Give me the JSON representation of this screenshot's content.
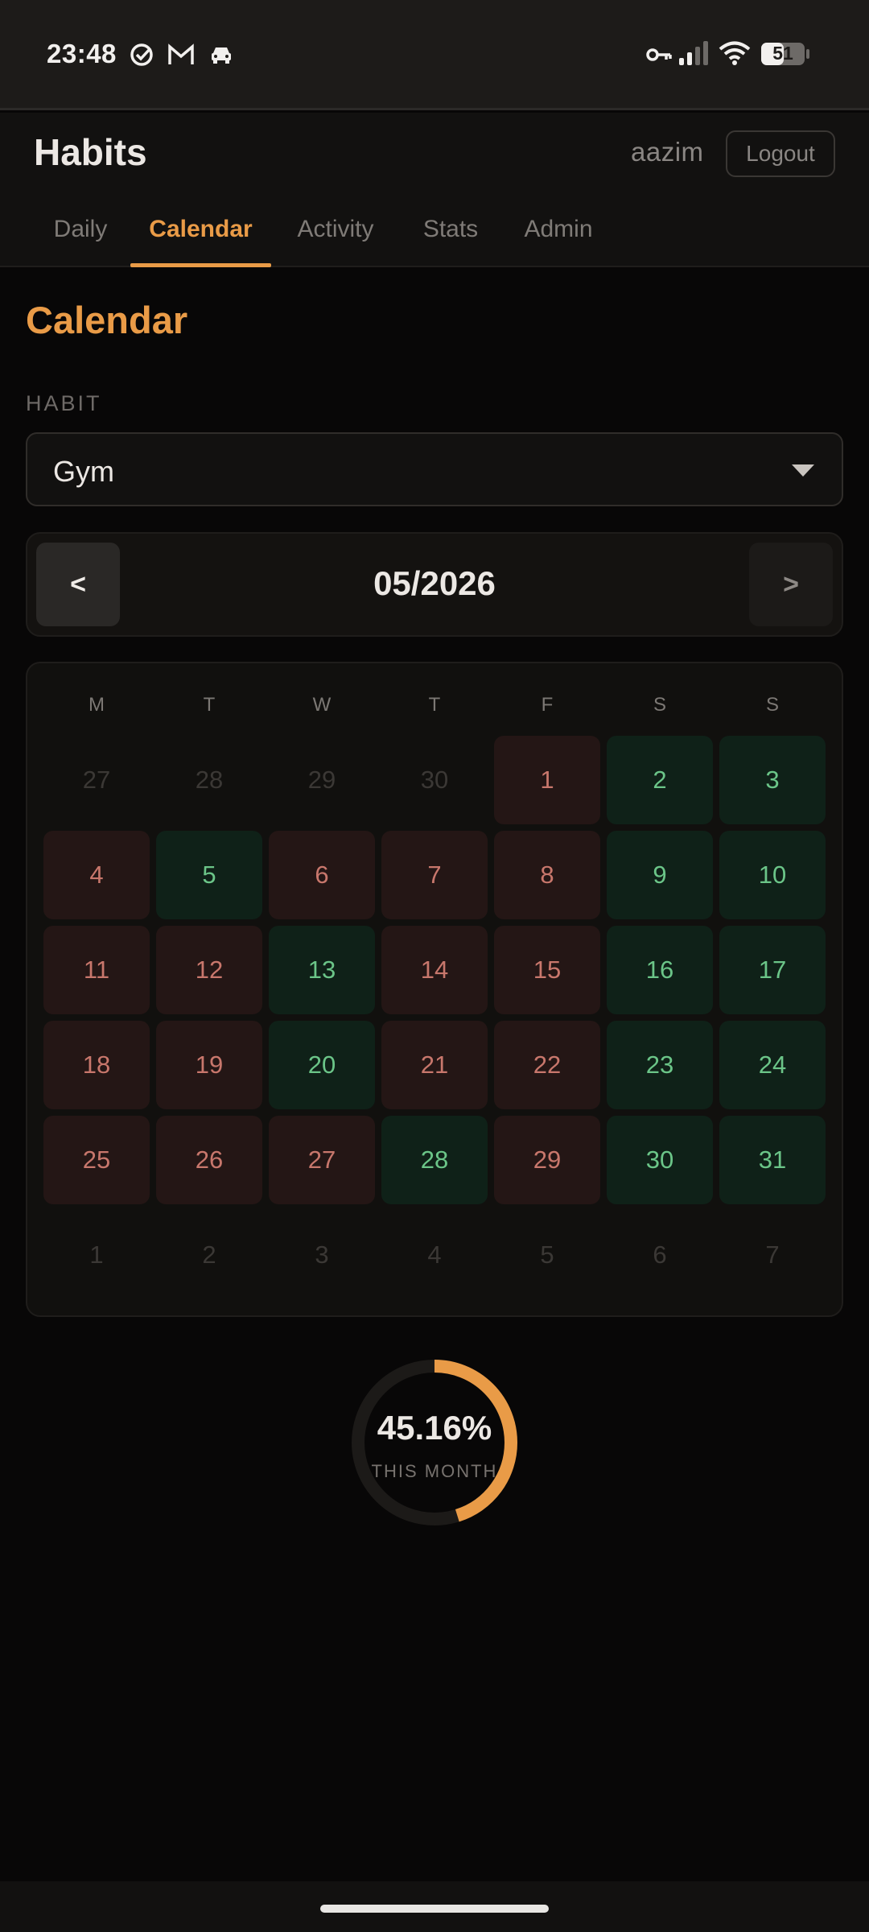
{
  "status_bar": {
    "time": "23:48",
    "left_icons": [
      "check-circle-icon",
      "gmail-icon",
      "car-icon"
    ],
    "right_icons": [
      "vpn-key-icon",
      "cell-signal-icon",
      "wifi-icon",
      "battery-icon"
    ],
    "battery": "51"
  },
  "header": {
    "title": "Habits",
    "username": "aazim",
    "logout_label": "Logout",
    "tabs": [
      {
        "label": "Daily",
        "active": false
      },
      {
        "label": "Calendar",
        "active": true
      },
      {
        "label": "Activity",
        "active": false
      },
      {
        "label": "Stats",
        "active": false
      },
      {
        "label": "Admin",
        "active": false
      }
    ]
  },
  "main": {
    "heading": "Calendar",
    "habit_label": "HABIT",
    "habit_value": "Gym",
    "prev_label": "<",
    "next_label": ">",
    "month": "05/2026",
    "weekdays": [
      "M",
      "T",
      "W",
      "T",
      "F",
      "S",
      "S"
    ],
    "weeks": [
      [
        {
          "d": "27",
          "s": "out"
        },
        {
          "d": "28",
          "s": "out"
        },
        {
          "d": "29",
          "s": "out"
        },
        {
          "d": "30",
          "s": "out"
        },
        {
          "d": "1",
          "s": "miss"
        },
        {
          "d": "2",
          "s": "done"
        },
        {
          "d": "3",
          "s": "done"
        }
      ],
      [
        {
          "d": "4",
          "s": "miss"
        },
        {
          "d": "5",
          "s": "done"
        },
        {
          "d": "6",
          "s": "miss"
        },
        {
          "d": "7",
          "s": "miss"
        },
        {
          "d": "8",
          "s": "miss"
        },
        {
          "d": "9",
          "s": "done"
        },
        {
          "d": "10",
          "s": "done"
        }
      ],
      [
        {
          "d": "11",
          "s": "miss"
        },
        {
          "d": "12",
          "s": "miss"
        },
        {
          "d": "13",
          "s": "done"
        },
        {
          "d": "14",
          "s": "miss"
        },
        {
          "d": "15",
          "s": "miss"
        },
        {
          "d": "16",
          "s": "done"
        },
        {
          "d": "17",
          "s": "done"
        }
      ],
      [
        {
          "d": "18",
          "s": "miss"
        },
        {
          "d": "19",
          "s": "miss"
        },
        {
          "d": "20",
          "s": "done"
        },
        {
          "d": "21",
          "s": "miss"
        },
        {
          "d": "22",
          "s": "miss"
        },
        {
          "d": "23",
          "s": "done"
        },
        {
          "d": "24",
          "s": "done"
        }
      ],
      [
        {
          "d": "25",
          "s": "miss"
        },
        {
          "d": "26",
          "s": "miss"
        },
        {
          "d": "27",
          "s": "miss"
        },
        {
          "d": "28",
          "s": "done"
        },
        {
          "d": "29",
          "s": "miss"
        },
        {
          "d": "30",
          "s": "done"
        },
        {
          "d": "31",
          "s": "done"
        }
      ],
      [
        {
          "d": "1",
          "s": "out"
        },
        {
          "d": "2",
          "s": "out"
        },
        {
          "d": "3",
          "s": "out"
        },
        {
          "d": "4",
          "s": "out"
        },
        {
          "d": "5",
          "s": "out"
        },
        {
          "d": "6",
          "s": "out"
        },
        {
          "d": "7",
          "s": "out"
        }
      ]
    ],
    "progress": {
      "value_text": "45.16%",
      "fraction": 0.4516,
      "caption": "THIS MONTH"
    }
  },
  "colors": {
    "accent": "#e99b47",
    "done_bg": "#0f2118",
    "done_text": "#6bc588",
    "miss_bg": "#241615",
    "miss_text": "#c8776c",
    "background": "#080707"
  }
}
